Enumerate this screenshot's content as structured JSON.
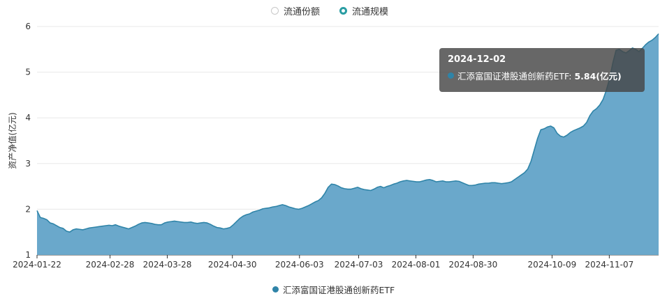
{
  "toggles": [
    {
      "label": "流通份额",
      "selected": false
    },
    {
      "label": "流通规模",
      "selected": true
    }
  ],
  "colors": {
    "accent": "#2a9da3",
    "area": "#6aa8cb",
    "line": "#2f84a8"
  },
  "tooltip": {
    "date": "2024-12-02",
    "series": "汇添富国证港股通创新药ETF:",
    "value": "5.84(亿元)"
  },
  "chart_data": {
    "type": "area",
    "ylabel": "资产净值(亿元)",
    "ylim": [
      1,
      6
    ],
    "yticks": [
      "1",
      "2",
      "3",
      "4",
      "5",
      "6"
    ],
    "xticks": [
      "2024-01-22",
      "2024-02-28",
      "2024-03-28",
      "2024-04-30",
      "2024-06-03",
      "2024-07-03",
      "2024-08-01",
      "2024-08-30",
      "2024-10-09",
      "2024-11-07"
    ],
    "x_start": "2024-01-22",
    "x_end": "2024-12-02",
    "grid": true,
    "legend_position": "bottom",
    "series": [
      {
        "name": "汇添富国证港股通创新药ETF",
        "values": [
          1.97,
          1.82,
          1.8,
          1.77,
          1.7,
          1.68,
          1.64,
          1.6,
          1.58,
          1.52,
          1.5,
          1.55,
          1.57,
          1.56,
          1.55,
          1.57,
          1.59,
          1.6,
          1.61,
          1.62,
          1.63,
          1.64,
          1.65,
          1.64,
          1.66,
          1.63,
          1.61,
          1.59,
          1.57,
          1.6,
          1.63,
          1.67,
          1.7,
          1.71,
          1.7,
          1.69,
          1.67,
          1.66,
          1.66,
          1.7,
          1.72,
          1.73,
          1.74,
          1.73,
          1.72,
          1.71,
          1.71,
          1.72,
          1.7,
          1.69,
          1.7,
          1.71,
          1.7,
          1.67,
          1.63,
          1.6,
          1.59,
          1.57,
          1.58,
          1.6,
          1.66,
          1.73,
          1.8,
          1.85,
          1.88,
          1.9,
          1.94,
          1.96,
          1.98,
          2.01,
          2.02,
          2.03,
          2.05,
          2.06,
          2.08,
          2.1,
          2.08,
          2.05,
          2.03,
          2.01,
          2.0,
          2.02,
          2.05,
          2.08,
          2.12,
          2.16,
          2.19,
          2.25,
          2.35,
          2.48,
          2.55,
          2.54,
          2.51,
          2.47,
          2.45,
          2.44,
          2.44,
          2.46,
          2.48,
          2.45,
          2.43,
          2.42,
          2.41,
          2.44,
          2.48,
          2.5,
          2.47,
          2.5,
          2.52,
          2.55,
          2.57,
          2.6,
          2.62,
          2.63,
          2.62,
          2.61,
          2.6,
          2.6,
          2.62,
          2.64,
          2.65,
          2.63,
          2.6,
          2.61,
          2.62,
          2.6,
          2.6,
          2.61,
          2.62,
          2.61,
          2.58,
          2.55,
          2.52,
          2.52,
          2.53,
          2.55,
          2.56,
          2.57,
          2.57,
          2.58,
          2.58,
          2.57,
          2.56,
          2.57,
          2.58,
          2.6,
          2.65,
          2.7,
          2.75,
          2.8,
          2.88,
          3.05,
          3.3,
          3.55,
          3.74,
          3.76,
          3.8,
          3.82,
          3.78,
          3.66,
          3.6,
          3.58,
          3.62,
          3.68,
          3.72,
          3.75,
          3.78,
          3.82,
          3.9,
          4.05,
          4.15,
          4.2,
          4.28,
          4.4,
          4.6,
          4.85,
          5.2,
          5.48,
          5.5,
          5.45,
          5.42,
          5.47,
          5.53,
          5.5,
          5.45,
          5.52,
          5.6,
          5.66,
          5.7,
          5.76,
          5.84
        ]
      }
    ]
  }
}
